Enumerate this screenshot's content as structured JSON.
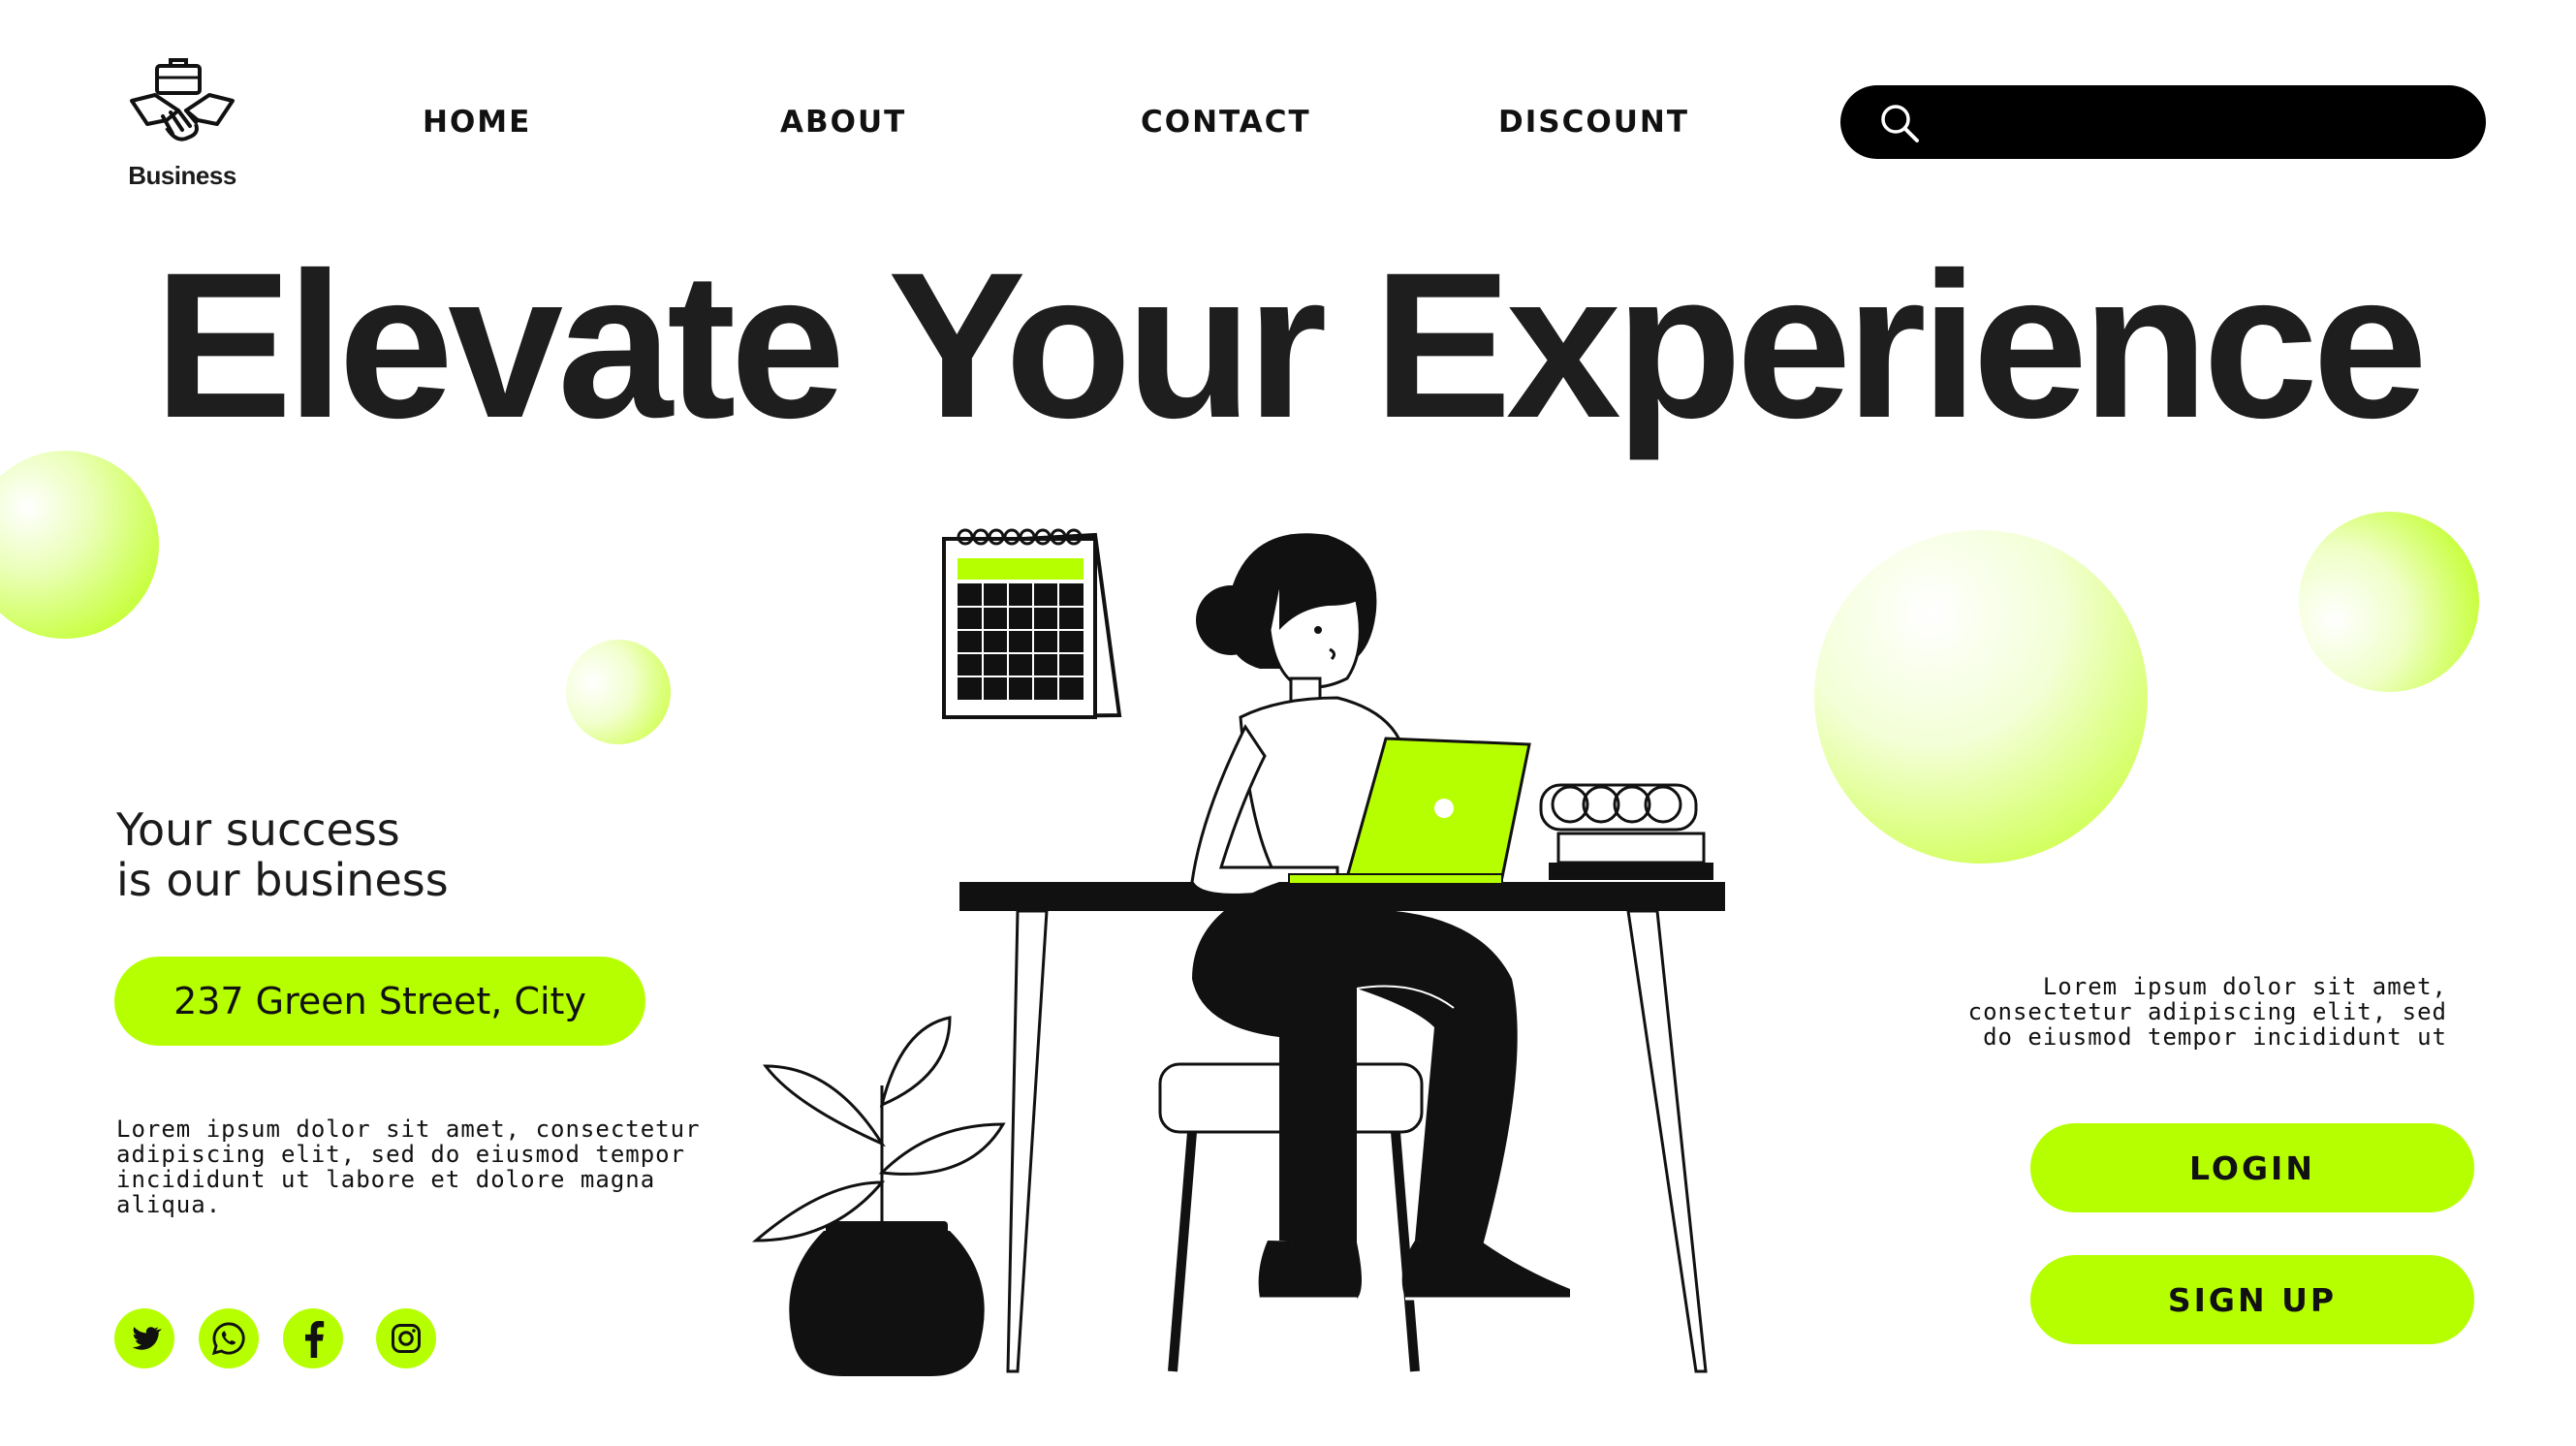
{
  "brand": {
    "logo_text": "Business"
  },
  "nav": {
    "home": "HOME",
    "about": "ABOUT",
    "contact": "CONTACT",
    "discount": "DISCOUNT"
  },
  "search": {
    "placeholder": ""
  },
  "hero": {
    "headline": "Elevate Your Experience"
  },
  "left": {
    "tagline_line1": "Your success",
    "tagline_line2": "is our business",
    "address": "237 Green Street, City",
    "body_line1": "Lorem ipsum dolor sit amet, consectetur",
    "body_line2": "adipiscing elit, sed do eiusmod tempor",
    "body_line3": "incididunt ut labore et dolore magna aliqua."
  },
  "right": {
    "body_line1": "Lorem ipsum dolor sit amet,",
    "body_line2": "consectetur adipiscing elit, sed",
    "body_line3": "do eiusmod tempor incididunt ut",
    "login_label": "LOGIN",
    "signup_label": "SIGN UP"
  },
  "social": [
    "twitter-icon",
    "whatsapp-icon",
    "facebook-icon",
    "instagram-icon"
  ],
  "colors": {
    "accent": "#b6ff00",
    "text": "#1b1b1b",
    "search_bg": "#000000",
    "background": "#ffffff"
  }
}
